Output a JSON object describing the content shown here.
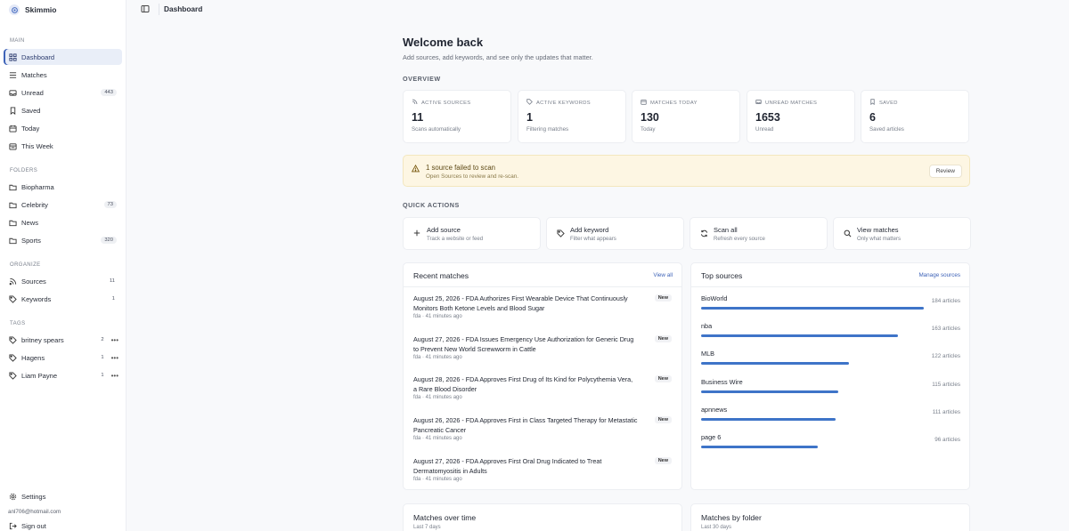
{
  "brand": {
    "name": "Skimmio"
  },
  "sidebar": {
    "main_label": "MAIN",
    "main_items": [
      {
        "label": "Dashboard",
        "icon": "grid-icon",
        "active": true
      },
      {
        "label": "Matches",
        "icon": "list-icon"
      },
      {
        "label": "Unread",
        "icon": "inbox-icon",
        "count": "443"
      },
      {
        "label": "Saved",
        "icon": "bookmark-icon"
      },
      {
        "label": "Today",
        "icon": "calendar-icon"
      },
      {
        "label": "This Week",
        "icon": "calendar-week-icon"
      }
    ],
    "folders_label": "FOLDERS",
    "folders": [
      {
        "label": "Biopharma"
      },
      {
        "label": "Celebrity",
        "count": "73"
      },
      {
        "label": "News"
      },
      {
        "label": "Sports",
        "count": "320"
      }
    ],
    "organize_label": "ORGANIZE",
    "organize": [
      {
        "label": "Sources",
        "count": "11"
      },
      {
        "label": "Keywords",
        "count": "1"
      }
    ],
    "tags_label": "TAGS",
    "tags": [
      {
        "label": "britney spears",
        "count": "2",
        "menu": "•••"
      },
      {
        "label": "Hagens",
        "count": "1",
        "menu": "•••"
      },
      {
        "label": "Liam Payne",
        "count": "1",
        "menu": "•••"
      }
    ],
    "settings_label": "Settings",
    "user_email": "anl706@hotmail.com",
    "signout_label": "Sign out"
  },
  "topbar": {
    "breadcrumb": "Dashboard"
  },
  "main": {
    "title": "Welcome back",
    "subtitle": "Add sources, add keywords, and see only the updates that matter.",
    "overview_label": "OVERVIEW",
    "stats": [
      {
        "label": "ACTIVE SOURCES",
        "value": "11",
        "caption": "Scans automatically",
        "icon": "rss-icon"
      },
      {
        "label": "ACTIVE KEYWORDS",
        "value": "1",
        "caption": "Filtering matches",
        "icon": "tag-icon"
      },
      {
        "label": "MATCHES TODAY",
        "value": "130",
        "caption": "Today",
        "icon": "calendar-icon"
      },
      {
        "label": "UNREAD MATCHES",
        "value": "1653",
        "caption": "Unread",
        "icon": "mail-icon"
      },
      {
        "label": "SAVED",
        "value": "6",
        "caption": "Saved articles",
        "icon": "bookmark-icon"
      }
    ],
    "alert": {
      "title": "1 source failed to scan",
      "subtitle": "Open Sources to review and re-scan.",
      "button": "Review"
    },
    "quick_actions_label": "QUICK ACTIONS",
    "quick_actions": [
      {
        "title": "Add source",
        "subtitle": "Track a website or feed",
        "icon": "plus-icon"
      },
      {
        "title": "Add keyword",
        "subtitle": "Filter what appears",
        "icon": "tag-icon"
      },
      {
        "title": "Scan all",
        "subtitle": "Refresh every source",
        "icon": "refresh-icon"
      },
      {
        "title": "View matches",
        "subtitle": "Only what matters",
        "icon": "search-icon"
      }
    ],
    "recent": {
      "title": "Recent matches",
      "link": "View all",
      "items": [
        {
          "title": "August 25, 2026 - FDA Authorizes First Wearable Device That Continuously Monitors Both Ketone Levels and Blood Sugar",
          "meta": "fda · 41 minutes ago",
          "badge": "New"
        },
        {
          "title": "August 27, 2026 - FDA Issues Emergency Use Authorization for Generic Drug to Prevent New World Screwworm in Cattle",
          "meta": "fda · 41 minutes ago",
          "badge": "New"
        },
        {
          "title": "August 28, 2026 - FDA Approves First Drug of Its Kind for Polycythemia Vera, a Rare Blood Disorder",
          "meta": "fda · 41 minutes ago",
          "badge": "New"
        },
        {
          "title": "August 26, 2026 - FDA Approves First in Class Targeted Therapy for Metastatic Pancreatic Cancer",
          "meta": "fda · 41 minutes ago",
          "badge": "New"
        },
        {
          "title": "August 27, 2026 - FDA Approves First Oral Drug Indicated to Treat Dermatomyositis in Adults",
          "meta": "fda · 41 minutes ago",
          "badge": "New"
        }
      ]
    },
    "top_sources": {
      "title": "Top sources",
      "link": "Manage sources",
      "items": [
        {
          "name": "BioWorld",
          "count": "184 articles",
          "fill": 0.86
        },
        {
          "name": "nba",
          "count": "163 articles",
          "fill": 0.76
        },
        {
          "name": "MLB",
          "count": "122 articles",
          "fill": 0.57
        },
        {
          "name": "Business Wire",
          "count": "115 articles",
          "fill": 0.53
        },
        {
          "name": "apnnews",
          "count": "111 articles",
          "fill": 0.52
        },
        {
          "name": "page 6",
          "count": "96 articles",
          "fill": 0.45
        }
      ]
    },
    "matches_over_time": {
      "title": "Matches over time",
      "subtitle": "Last 7 days"
    },
    "matches_by_folder": {
      "title": "Matches by folder",
      "subtitle": "Last 30 days"
    }
  }
}
